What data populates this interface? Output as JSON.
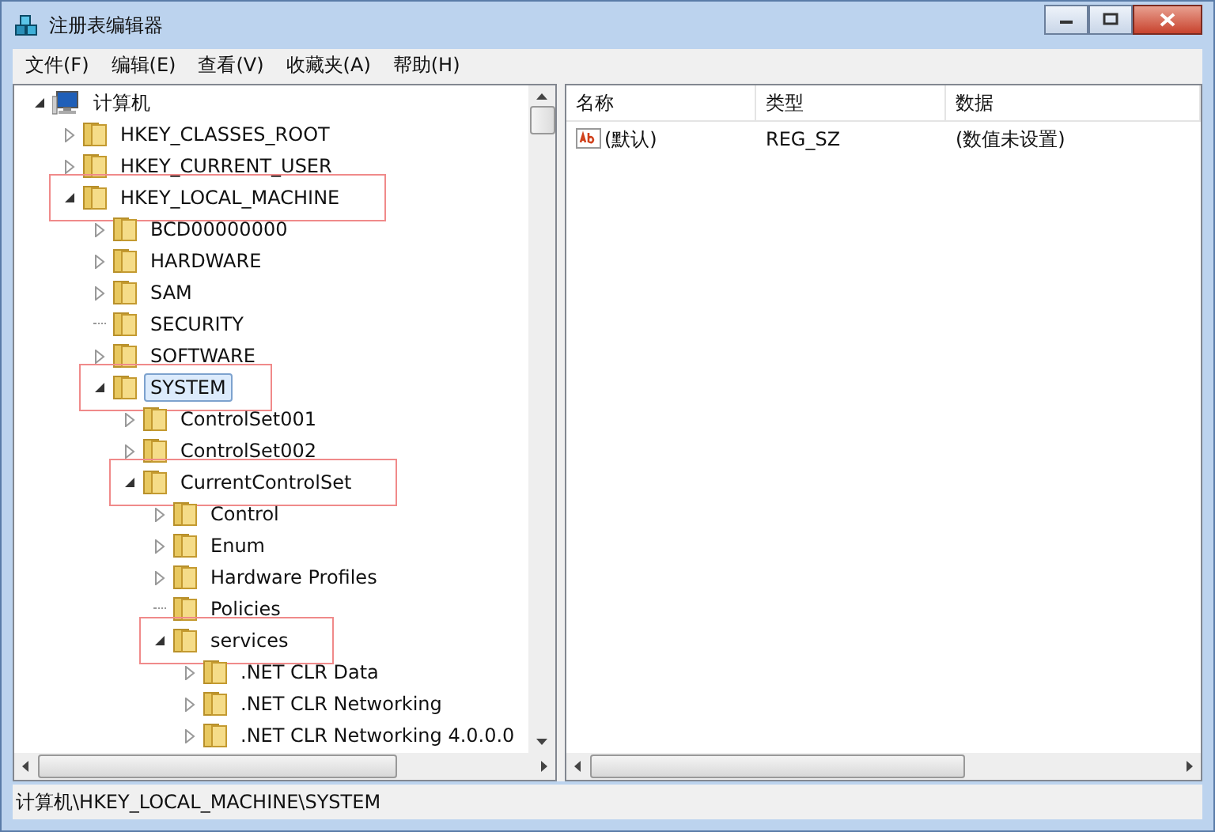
{
  "window": {
    "title": "注册表编辑器"
  },
  "menu": [
    "文件(F)",
    "编辑(E)",
    "查看(V)",
    "收藏夹(A)",
    "帮助(H)"
  ],
  "tree": [
    {
      "label": "计算机",
      "kind": "computer",
      "has_children": true,
      "expanded": true,
      "selected": false,
      "highlighted": false,
      "children": [
        {
          "label": "HKEY_CLASSES_ROOT",
          "kind": "folder",
          "has_children": true,
          "expanded": false,
          "selected": false,
          "highlighted": false
        },
        {
          "label": "HKEY_CURRENT_USER",
          "kind": "folder",
          "has_children": true,
          "expanded": false,
          "selected": false,
          "highlighted": false
        },
        {
          "label": "HKEY_LOCAL_MACHINE",
          "kind": "folder",
          "has_children": true,
          "expanded": true,
          "selected": false,
          "highlighted": true,
          "children": [
            {
              "label": "BCD00000000",
              "kind": "folder",
              "has_children": true,
              "expanded": false,
              "selected": false,
              "highlighted": false
            },
            {
              "label": "HARDWARE",
              "kind": "folder",
              "has_children": true,
              "expanded": false,
              "selected": false,
              "highlighted": false
            },
            {
              "label": "SAM",
              "kind": "folder",
              "has_children": true,
              "expanded": false,
              "selected": false,
              "highlighted": false
            },
            {
              "label": "SECURITY",
              "kind": "folder",
              "has_children": false,
              "selected": false,
              "highlighted": false
            },
            {
              "label": "SOFTWARE",
              "kind": "folder",
              "has_children": true,
              "expanded": false,
              "selected": false,
              "highlighted": false
            },
            {
              "label": "SYSTEM",
              "kind": "folder",
              "has_children": true,
              "expanded": true,
              "selected": true,
              "highlighted": true,
              "children": [
                {
                  "label": "ControlSet001",
                  "kind": "folder",
                  "has_children": true,
                  "expanded": false,
                  "selected": false,
                  "highlighted": false
                },
                {
                  "label": "ControlSet002",
                  "kind": "folder",
                  "has_children": true,
                  "expanded": false,
                  "selected": false,
                  "highlighted": false
                },
                {
                  "label": "CurrentControlSet",
                  "kind": "folder",
                  "has_children": true,
                  "expanded": true,
                  "selected": false,
                  "highlighted": true,
                  "children": [
                    {
                      "label": "Control",
                      "kind": "folder",
                      "has_children": true,
                      "expanded": false,
                      "selected": false,
                      "highlighted": false
                    },
                    {
                      "label": "Enum",
                      "kind": "folder",
                      "has_children": true,
                      "expanded": false,
                      "selected": false,
                      "highlighted": false
                    },
                    {
                      "label": "Hardware Profiles",
                      "kind": "folder",
                      "has_children": true,
                      "expanded": false,
                      "selected": false,
                      "highlighted": false
                    },
                    {
                      "label": "Policies",
                      "kind": "folder",
                      "has_children": false,
                      "selected": false,
                      "highlighted": false
                    },
                    {
                      "label": "services",
                      "kind": "folder",
                      "has_children": true,
                      "expanded": true,
                      "selected": false,
                      "highlighted": true,
                      "children": [
                        {
                          "label": ".NET CLR Data",
                          "kind": "folder",
                          "has_children": true,
                          "expanded": false,
                          "selected": false,
                          "highlighted": false
                        },
                        {
                          "label": ".NET CLR Networking",
                          "kind": "folder",
                          "has_children": true,
                          "expanded": false,
                          "selected": false,
                          "highlighted": false
                        },
                        {
                          "label": ".NET CLR Networking 4.0.0.0",
                          "kind": "folder",
                          "has_children": true,
                          "expanded": false,
                          "selected": false,
                          "highlighted": false
                        }
                      ]
                    }
                  ]
                }
              ]
            }
          ]
        }
      ]
    }
  ],
  "columns": [
    "名称",
    "类型",
    "数据"
  ],
  "values": [
    {
      "name": "(默认)",
      "type": "REG_SZ",
      "data": "(数值未设置)"
    }
  ],
  "status_bar": "计算机\\HKEY_LOCAL_MACHINE\\SYSTEM"
}
